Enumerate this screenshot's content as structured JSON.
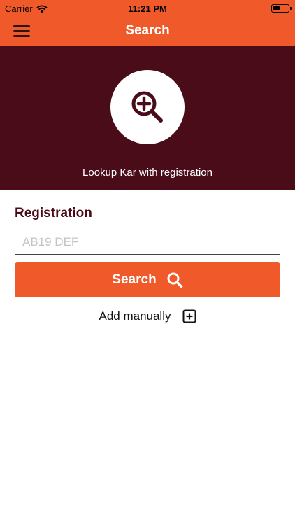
{
  "status_bar": {
    "carrier": "Carrier",
    "time": "11:21 PM"
  },
  "nav": {
    "title": "Search",
    "menu_icon": "hamburger-menu-icon"
  },
  "hero": {
    "icon": "zoom-in-icon",
    "caption": "Lookup Kar with registration"
  },
  "form": {
    "label": "Registration",
    "placeholder": "AB19 DEF",
    "value": ""
  },
  "search_button": {
    "label": "Search",
    "icon": "search-icon"
  },
  "add_manually": {
    "label": "Add manually",
    "icon": "plus-square-icon"
  },
  "colors": {
    "accent": "#f0592a",
    "hero_bg": "#4a0c19",
    "dark_text": "#2b1516",
    "background": "#ffffff"
  }
}
